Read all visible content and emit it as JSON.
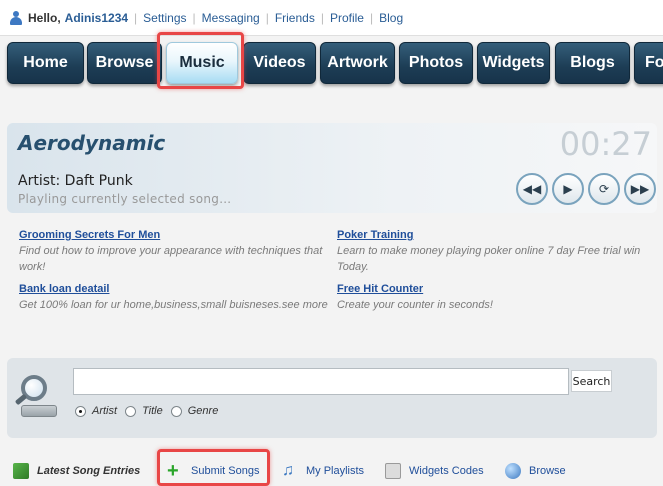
{
  "topbar": {
    "hello": "Hello,",
    "username": "Adinis1234",
    "links": [
      "Settings",
      "Messaging",
      "Friends",
      "Profile",
      "Blog"
    ]
  },
  "nav": {
    "tabs": [
      "Home",
      "Browse",
      "Music",
      "Videos",
      "Artwork",
      "Photos",
      "Widgets",
      "Blogs",
      "Fo"
    ],
    "active": "Music"
  },
  "player": {
    "song_title": "Aerodynamic",
    "time": "00:27",
    "artist_label": "Artist:",
    "artist": "Daft Punk",
    "status": "Playling currently selected song…",
    "controls": [
      "rewind-icon",
      "play-icon",
      "repeat-icon",
      "fast-forward-icon"
    ]
  },
  "ads": [
    {
      "title": "Grooming Secrets For Men",
      "desc": "Find out how to improve your appearance with techniques that work!"
    },
    {
      "title": "Poker Training",
      "desc": "Learn to make money playing poker online 7 day Free trial win Today."
    },
    {
      "title": "Bank loan deatail",
      "desc": "Get 100% loan for ur home,business,small buisneses.see more"
    },
    {
      "title": "Free Hit Counter",
      "desc": "Create your counter in seconds!"
    }
  ],
  "search": {
    "value": "",
    "placeholder": "",
    "button": "Search",
    "options": [
      "Artist",
      "Title",
      "Genre"
    ],
    "selected": "Artist"
  },
  "bottombar": {
    "latest": "Latest Song Entries",
    "submit": "Submit Songs",
    "playlists": "My Playlists",
    "widgets": "Widgets Codes",
    "browse": "Browse"
  },
  "colors": {
    "nav_dark": "#1d3d55",
    "nav_active": "#a7dcf3",
    "link": "#1f4e9a",
    "highlight": "#e84646"
  }
}
